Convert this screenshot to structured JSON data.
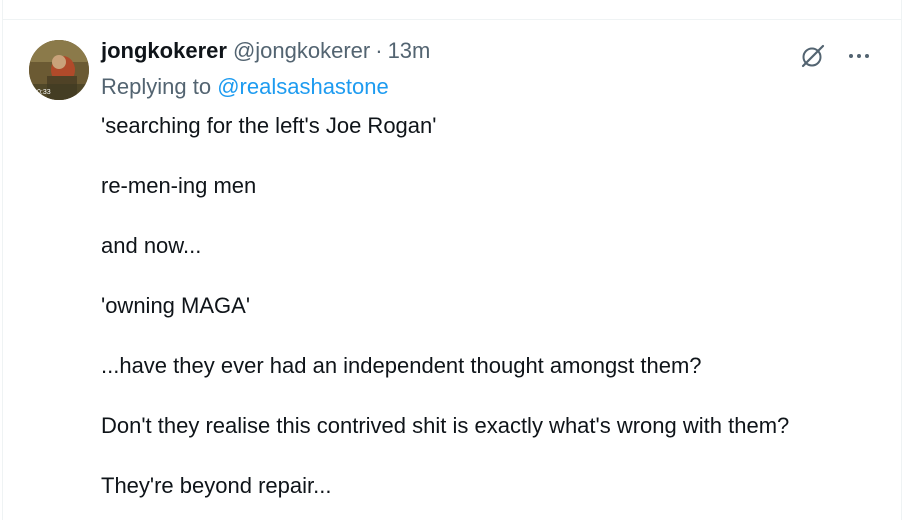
{
  "post": {
    "display_name": "jongkokerer",
    "handle": "@jongkokerer",
    "separator": "·",
    "timestamp": "13m",
    "replying_prefix": "Replying to",
    "replying_handle": "@realsashastone",
    "avatar_video_time": "0:33",
    "paragraphs": [
      "'searching for the left's Joe Rogan'",
      "re-men-ing men",
      "and now...",
      "'owning MAGA'",
      "...have they ever had an independent thought amongst them?",
      "Don't they realise this contrived shit is exactly what's wrong with them?",
      "They're beyond repair..."
    ]
  },
  "icons": {
    "grok": "grok-icon",
    "more": "more-options-icon"
  },
  "colors": {
    "text_primary": "#0f1419",
    "text_secondary": "#536471",
    "link": "#1d9bf0",
    "border": "#eff3f4"
  }
}
